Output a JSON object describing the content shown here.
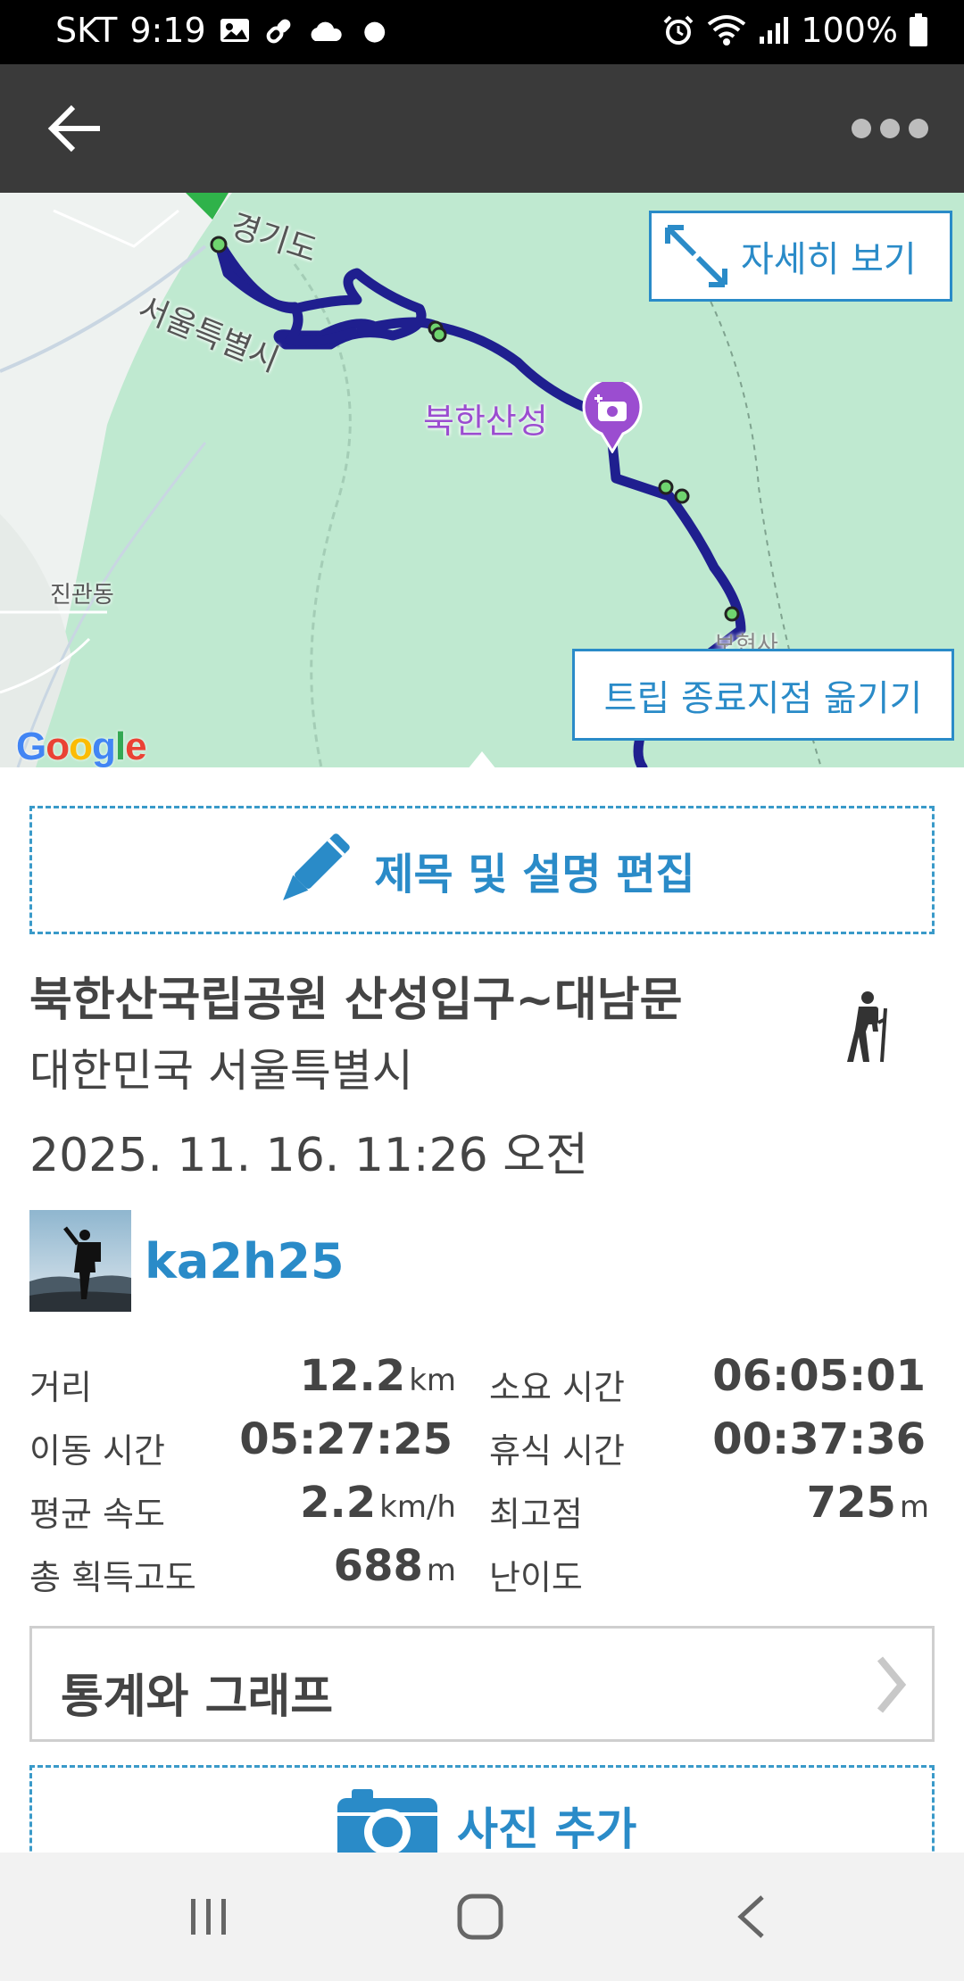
{
  "status_bar": {
    "carrier": "SKT",
    "time": "9:19",
    "battery": "100%",
    "left_icons": [
      "image-icon",
      "link-icon",
      "cloud-icon",
      "dot-icon"
    ],
    "right_icons": [
      "alarm-icon",
      "wifi-icon",
      "signal-icon",
      "battery-icon"
    ]
  },
  "app_bar": {
    "back_icon": "arrow-left-icon",
    "more_icon": "more-dots-icon"
  },
  "map": {
    "labels": {
      "gyeonggi": "경기도",
      "seoul": "서울특별시",
      "jingwan": "진관동",
      "poi": "북한산성",
      "partial": "보현사"
    },
    "detail_button": "자세히 보기",
    "move_end_button": "트립 종료지점 옮기기",
    "google_logo": "Google",
    "colors": {
      "route": "#1f1f8f",
      "park": "#a9e3c3",
      "accent": "#2a8bc8",
      "poi": "#9b4dd0"
    }
  },
  "edit": {
    "label": "제목 및 설명 편집",
    "icon": "pencil-icon"
  },
  "trip": {
    "title": "북한산국립공원 산성입구~대남문",
    "location": "대한민국 서울특별시",
    "date": "2025. 11. 16. 11:26 오전",
    "activity_icon": "hiker-icon"
  },
  "user": {
    "name": "ka2h25"
  },
  "stats": [
    {
      "left_label": "거리",
      "left_value": "12.2",
      "left_unit": "km",
      "right_label": "소요 시간",
      "right_value": "06:05:01",
      "right_unit": ""
    },
    {
      "left_label": "이동 시간",
      "left_value": "05:27:25",
      "left_unit": "",
      "right_label": "휴식 시간",
      "right_value": "00:37:36",
      "right_unit": ""
    },
    {
      "left_label": "평균 속도",
      "left_value": "2.2",
      "left_unit": "km/h",
      "right_label": "최고점",
      "right_value": "725",
      "right_unit": "m"
    },
    {
      "left_label": "총 획득고도",
      "left_value": "688",
      "left_unit": "m",
      "right_label": "난이도",
      "right_value": "",
      "right_unit": ""
    }
  ],
  "graph": {
    "label": "통계와 그래프",
    "chevron": "›"
  },
  "photo": {
    "label": "사진 추가",
    "icon": "camera-icon"
  },
  "nav_bar": {
    "icons": [
      "recent-apps-icon",
      "home-icon",
      "back-icon"
    ]
  }
}
